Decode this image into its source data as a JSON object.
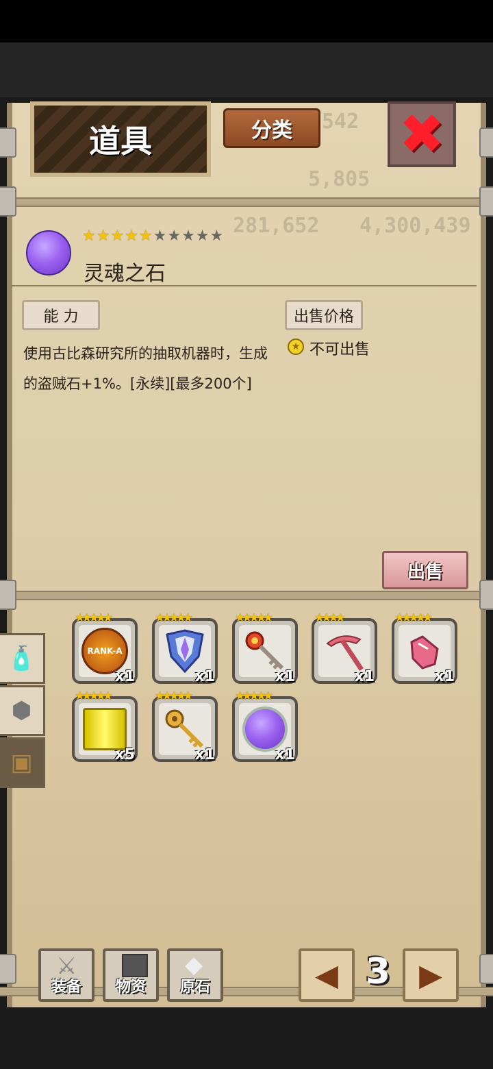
{
  "header": {
    "title": "道具",
    "classify_label": "分类",
    "close_icon": "close-x-icon",
    "background_numbers": [
      "542",
      "5,805",
      "4,300,439",
      "281,652"
    ]
  },
  "item": {
    "name": "灵魂之石",
    "stars_filled": "★★★★★",
    "stars_empty": "★★★★★",
    "rarity": 5,
    "max_rarity": 10,
    "icon": "purple-soul-stone-icon"
  },
  "ability": {
    "label": "能 力",
    "description": "使用古比森研究所的抽取机器时，生成的盗贼石+1%。[永续][最多200个]"
  },
  "sale": {
    "label": "出售价格",
    "status": "不可出售",
    "button": "出售"
  },
  "inventory": {
    "items": [
      {
        "icon": "rank-a-fist-badge-icon",
        "qty": "x1",
        "stars": "★★★★★"
      },
      {
        "icon": "crystal-shield-icon",
        "qty": "x1",
        "stars": "★★★★★"
      },
      {
        "icon": "red-gem-key-icon",
        "qty": "x1",
        "stars": "★★★★★"
      },
      {
        "icon": "pink-pickaxe-icon",
        "qty": "x1",
        "stars": "★★★★"
      },
      {
        "icon": "pink-glove-icon",
        "qty": "x1",
        "stars": "★★★★★"
      },
      {
        "icon": "golden-scroll-icon",
        "qty": "x5",
        "stars": "★★★★★"
      },
      {
        "icon": "golden-key-icon",
        "qty": "x1",
        "stars": "★★★★★"
      },
      {
        "icon": "purple-soul-stone-icon",
        "qty": "x1",
        "stars": "★★★★★"
      }
    ]
  },
  "side_tabs": [
    "potion-bottle-icon",
    "ore-rock-icon",
    "treasure-chest-icon"
  ],
  "bottom": {
    "equip_label": "装备",
    "materials_label": "物资",
    "gem_label": "原石",
    "page": "3"
  }
}
